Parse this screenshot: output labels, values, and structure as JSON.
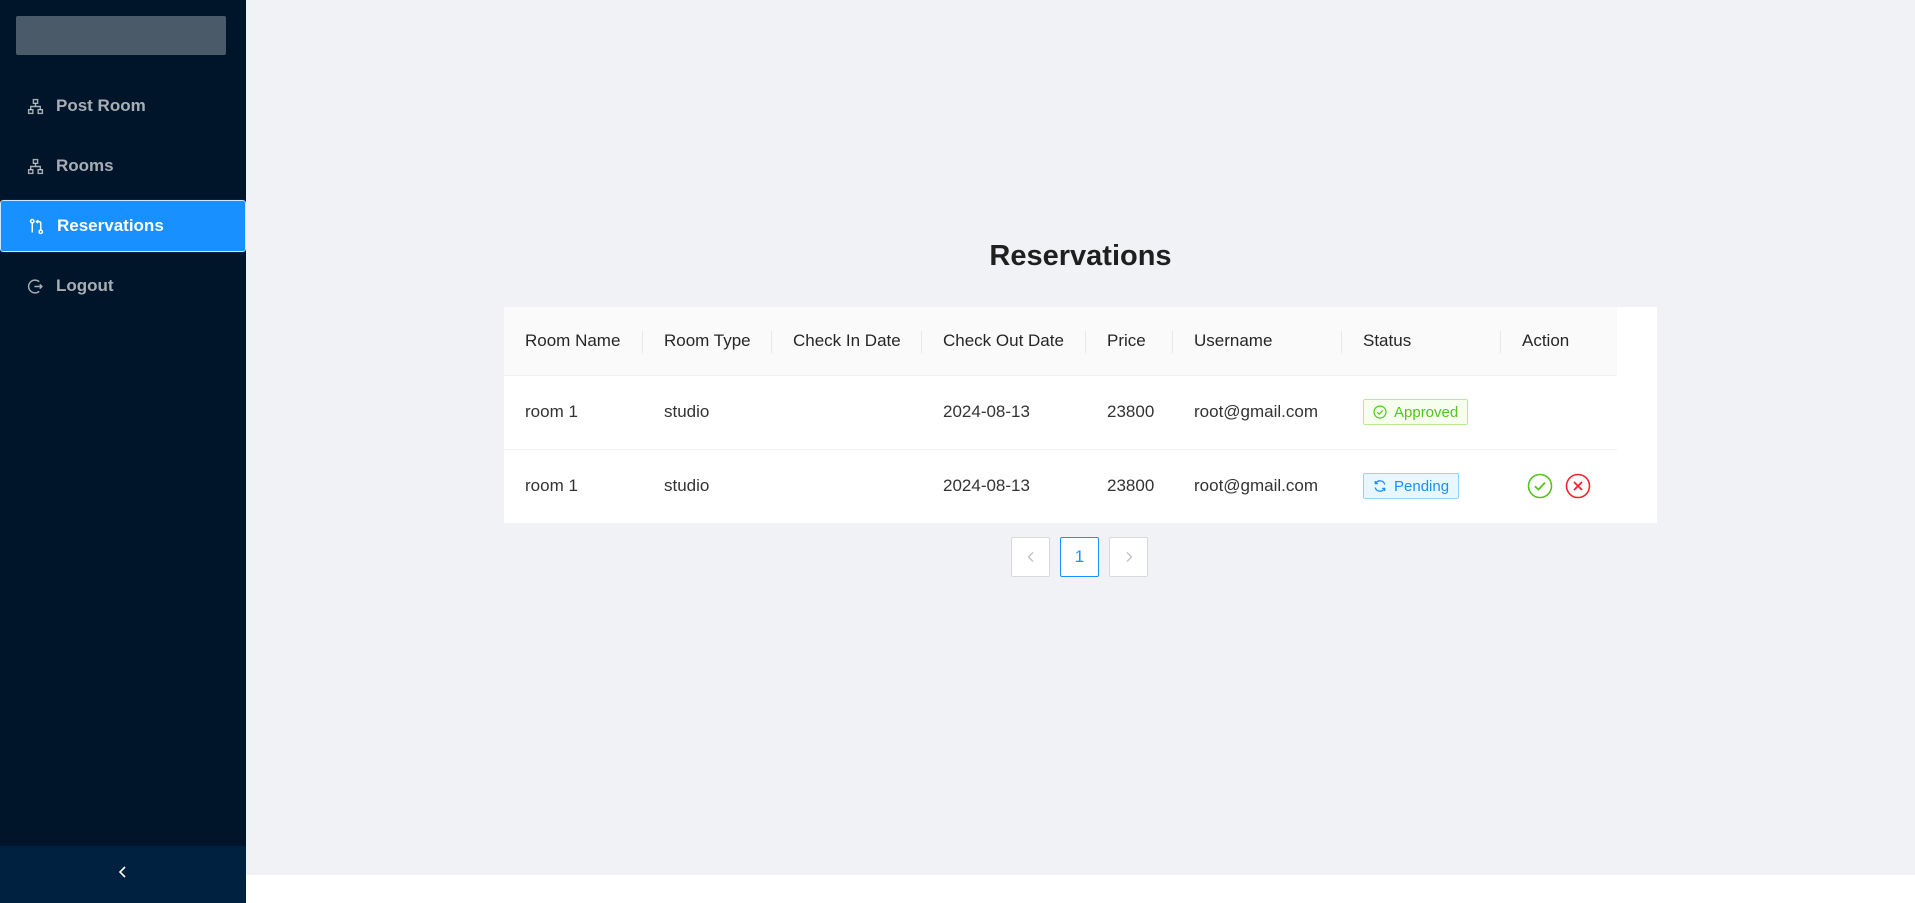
{
  "sidebar": {
    "items": [
      {
        "label": "Post Room",
        "icon": "cluster-icon"
      },
      {
        "label": "Rooms",
        "icon": "cluster-icon"
      },
      {
        "label": "Reservations",
        "icon": "pull-request-icon",
        "selected": true
      },
      {
        "label": "Logout",
        "icon": "logout-icon"
      }
    ],
    "collapse_icon": "chevron-left-icon"
  },
  "main": {
    "title": "Reservations",
    "table": {
      "columns": [
        "Room Name",
        "Room Type",
        "Check In Date",
        "Check Out Date",
        "Price",
        "Username",
        "Status",
        "Action"
      ],
      "rows": [
        {
          "room_name": "room 1",
          "room_type": "studio",
          "check_in": "",
          "check_out": "2024-08-13",
          "price": "23800",
          "username": "root@gmail.com",
          "status": "Approved"
        },
        {
          "room_name": "room 1",
          "room_type": "studio",
          "check_in": "",
          "check_out": "2024-08-13",
          "price": "23800",
          "username": "root@gmail.com",
          "status": "Pending"
        }
      ]
    },
    "pagination": {
      "current": "1"
    }
  },
  "colors": {
    "sidebar_bg": "#001529",
    "selected_bg": "#1890ff",
    "approved": "#52c41a",
    "pending": "#1890ff",
    "reject": "#f5222d"
  }
}
